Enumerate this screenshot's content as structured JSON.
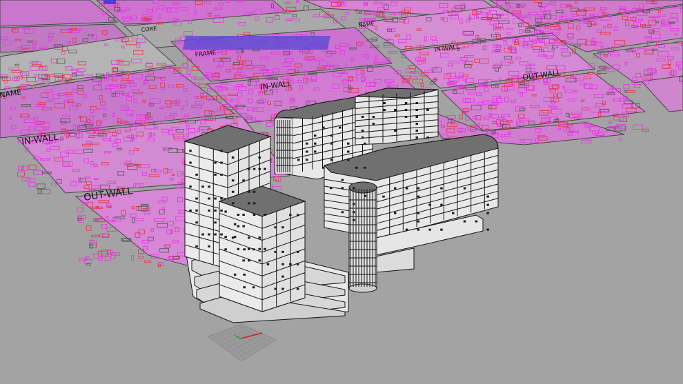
{
  "viewport": {
    "background": "#a3a3a3",
    "layout_sheet_labels": [
      {
        "id": "core",
        "text": "CORE"
      },
      {
        "id": "name-top",
        "text": "NAME"
      },
      {
        "id": "frame-mid",
        "text": "FRAME"
      },
      {
        "id": "name-left",
        "text": "NAME"
      },
      {
        "id": "in-wall-mid",
        "text": "IN-WALL"
      },
      {
        "id": "in-wall-right",
        "text": "IN-WALL"
      },
      {
        "id": "out-wall-right",
        "text": "OUT-WALL"
      },
      {
        "id": "in-wall-left",
        "text": "IN-WALL"
      },
      {
        "id": "out-wall-left",
        "text": "OUT-WALL"
      }
    ],
    "linework_colors": {
      "magenta": "#e235e2",
      "red": "#e0364a",
      "blue": "#4a3fe0",
      "dark": "#333333"
    },
    "model": {
      "facade_color": "#e8e8e8",
      "roof_color": "#707070",
      "edge_color": "#141414"
    },
    "gizmo": {
      "x_axis_color": "#d21e1e",
      "y_axis_color": "#2aa02a"
    }
  }
}
